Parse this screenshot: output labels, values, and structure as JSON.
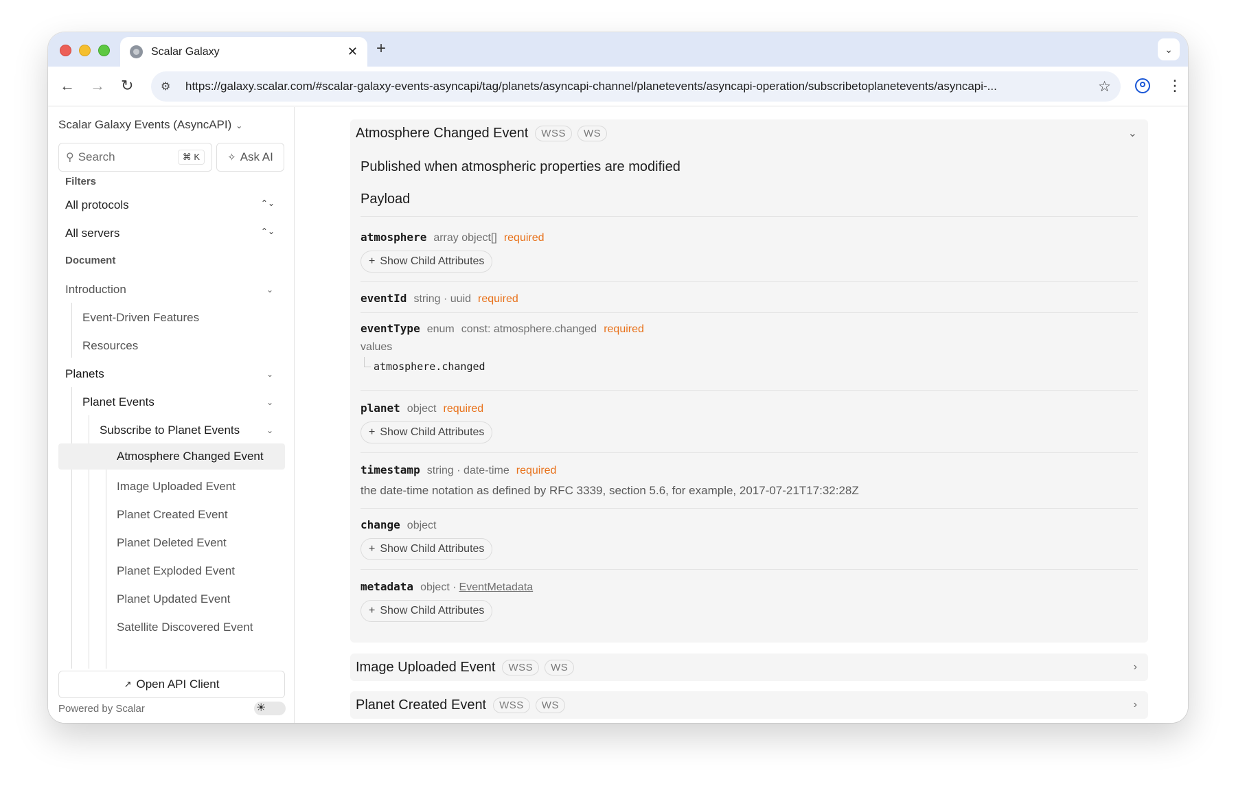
{
  "browser": {
    "tab_title": "Scalar Galaxy",
    "tab_close": "✕",
    "new_tab": "+",
    "tab_menu": "⌄",
    "url": "https://galaxy.scalar.com/#scalar-galaxy-events-asyncapi/tag/planets/asyncapi-channel/planetevents/asyncapi-operation/subscribetoplanetevents/asyncapi-...",
    "back": "←",
    "forward": "→",
    "reload": "↻",
    "site_info": "⚙",
    "star": "☆",
    "kebab": "⋮"
  },
  "sidebar": {
    "doc_title": "Scalar Galaxy Events (AsyncAPI)",
    "chevron": "⌄",
    "search_placeholder": "Search",
    "search_shortcut": "⌘ K",
    "ask_ai": "Ask AI",
    "filters_label": "Filters",
    "protocols": "All protocols",
    "servers": "All servers",
    "updown": "⌃⌄",
    "document_label": "Document",
    "nav": {
      "introduction": "Introduction",
      "event_driven": "Event-Driven Features",
      "resources": "Resources",
      "planets": "Planets",
      "planet_events": "Planet Events",
      "subscribe": "Subscribe to Planet Events",
      "events": [
        "Atmosphere Changed Event",
        "Image Uploaded Event",
        "Planet Created Event",
        "Planet Deleted Event",
        "Planet Exploded Event",
        "Planet Updated Event",
        "Satellite Discovered Event"
      ]
    },
    "open_client": "Open API Client",
    "powered_by": "Powered by Scalar"
  },
  "main": {
    "expanded": {
      "title": "Atmosphere Changed Event",
      "protocols": [
        "WSS",
        "WS"
      ],
      "description": "Published when atmospheric properties are modified",
      "payload_label": "Payload",
      "show_child": "Show Child Attributes",
      "required": "required",
      "props": {
        "atmosphere": {
          "name": "atmosphere",
          "type": "array object[]"
        },
        "eventId": {
          "name": "eventId",
          "type": "string · uuid"
        },
        "eventType": {
          "name": "eventType",
          "type": "enum",
          "const": "const:  atmosphere.changed",
          "values_label": "values",
          "value": "atmosphere.changed"
        },
        "planet": {
          "name": "planet",
          "type": "object"
        },
        "timestamp": {
          "name": "timestamp",
          "type": "string · date-time",
          "description": "the date-time notation as defined by RFC 3339, section 5.6, for example, 2017-07-21T17:32:28Z"
        },
        "change": {
          "name": "change",
          "type": "object"
        },
        "metadata": {
          "name": "metadata",
          "type": "object ·",
          "ref": "EventMetadata"
        }
      }
    },
    "collapsed": [
      {
        "title": "Image Uploaded Event",
        "protocols": [
          "WSS",
          "WS"
        ]
      },
      {
        "title": "Planet Created Event",
        "protocols": [
          "WSS",
          "WS"
        ]
      }
    ]
  }
}
